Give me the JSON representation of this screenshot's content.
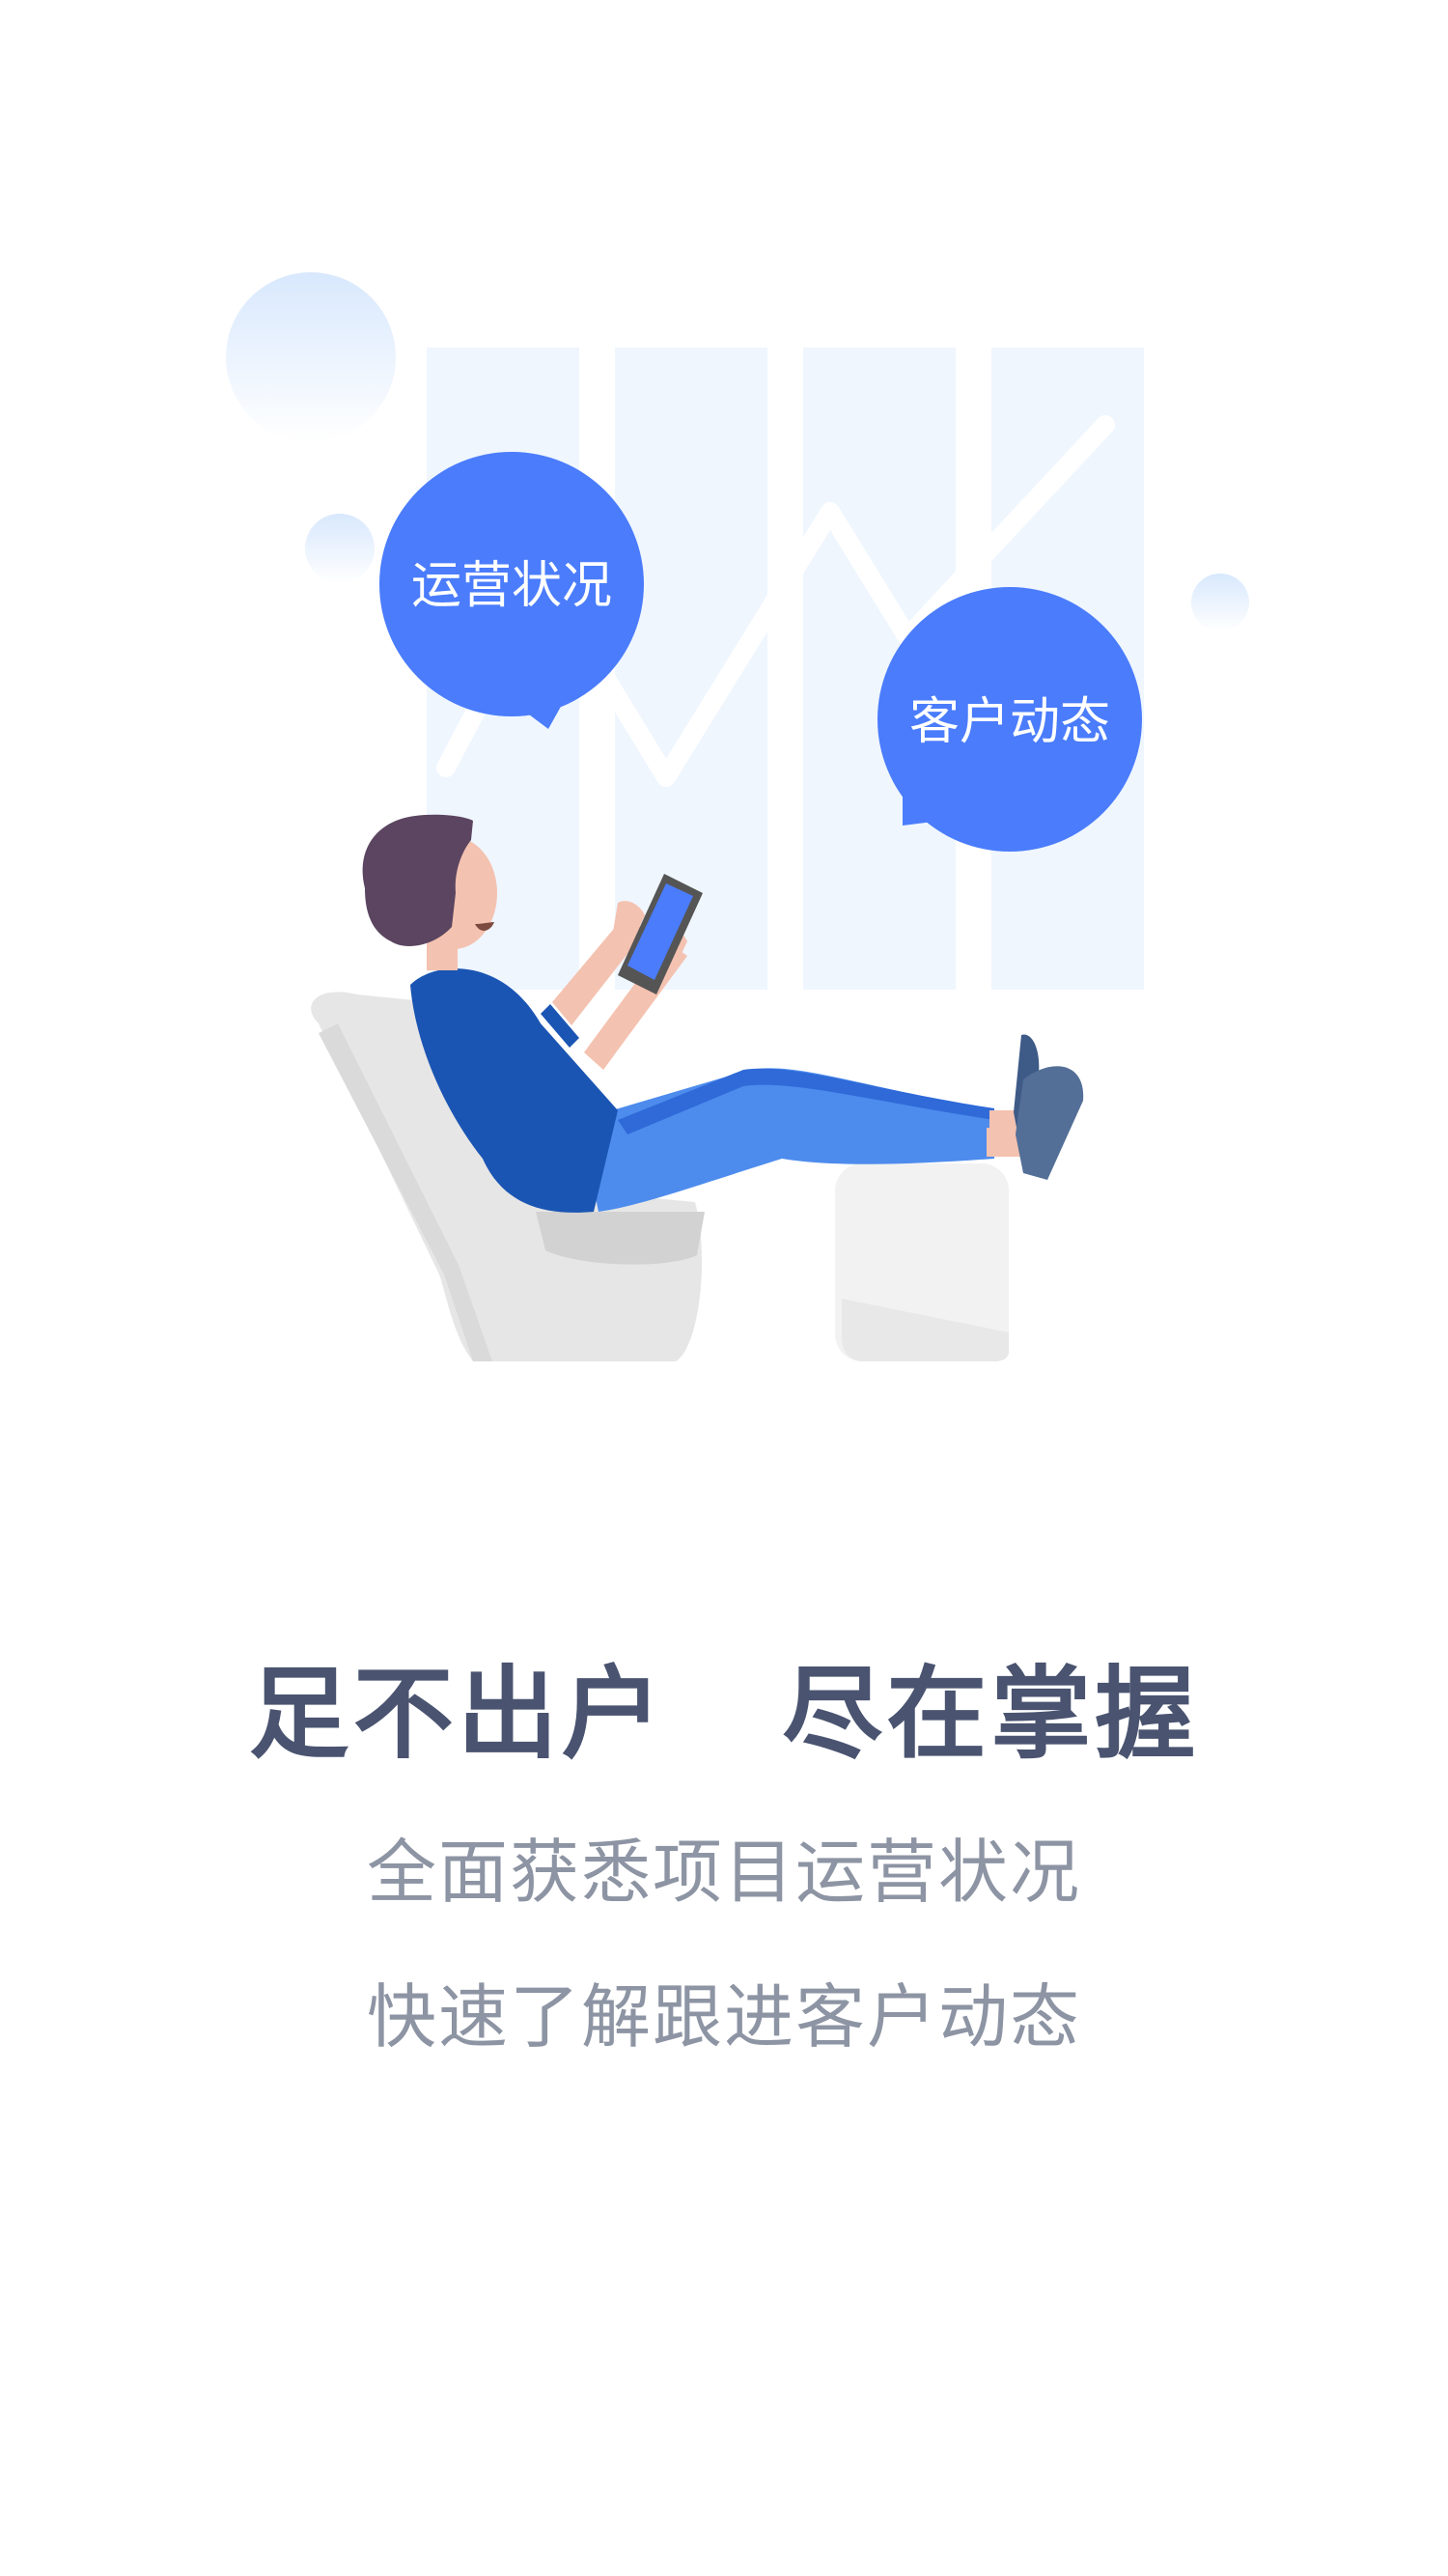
{
  "illustration": {
    "bubble_left_text": "运营状况",
    "bubble_right_text": "客户动态",
    "colors": {
      "bubble": "#4a7cfc",
      "panel": "#eff6fe",
      "chart_line": "#ffffff",
      "shirt": "#1a55b3",
      "pants": "#4d8ced",
      "chair": "#e6e6e6",
      "skin": "#f4c2b0",
      "hair": "#5b4560"
    }
  },
  "content": {
    "headline": "足不出户   尽在掌握",
    "line1": "全面获悉项目运营状况",
    "line2": "快速了解跟进客户动态"
  }
}
